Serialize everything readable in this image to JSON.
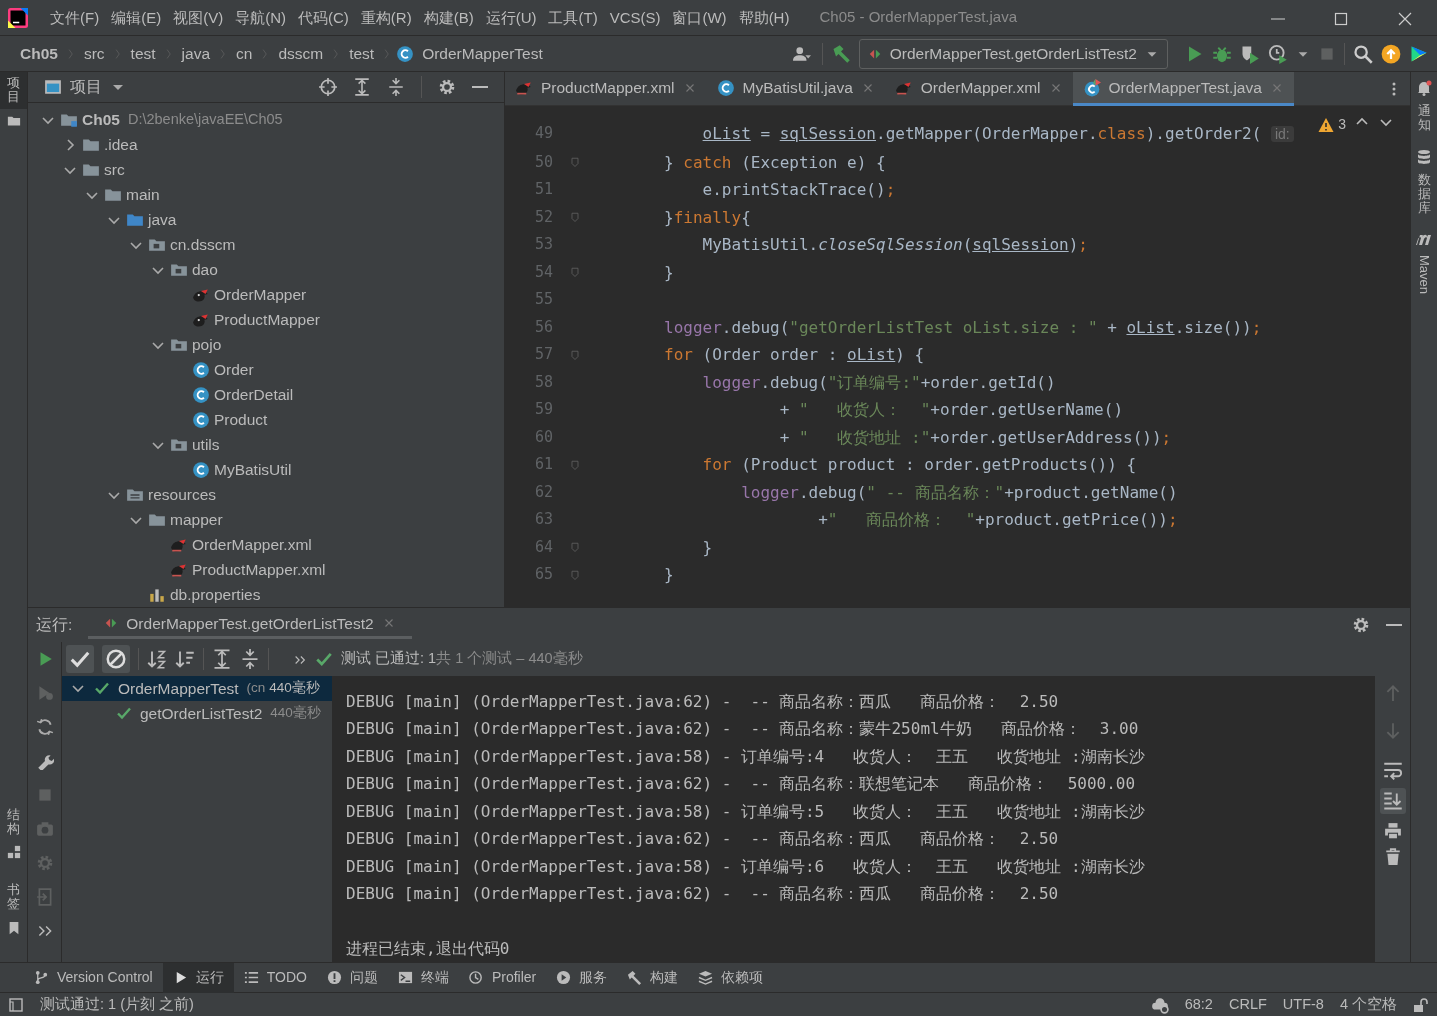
{
  "window": {
    "title": "Ch05 - OrderMapperTest.java"
  },
  "menu": [
    "文件(F)",
    "编辑(E)",
    "视图(V)",
    "导航(N)",
    "代码(C)",
    "重构(R)",
    "构建(B)",
    "运行(U)",
    "工具(T)",
    "VCS(S)",
    "窗口(W)",
    "帮助(H)"
  ],
  "breadcrumbs": [
    {
      "label": "Ch05",
      "kind": "root"
    },
    {
      "label": "src",
      "kind": "folder"
    },
    {
      "label": "test",
      "kind": "folder"
    },
    {
      "label": "java",
      "kind": "folder"
    },
    {
      "label": "cn",
      "kind": "folder"
    },
    {
      "label": "dsscm",
      "kind": "folder"
    },
    {
      "label": "test",
      "kind": "folder"
    },
    {
      "label": "OrderMapperTest",
      "kind": "class"
    }
  ],
  "run_configuration": {
    "label": "OrderMapperTest.getOrderListTest2"
  },
  "left_stripe": {
    "top": [
      {
        "label": "项目",
        "selected": true
      }
    ],
    "bottom": [
      {
        "label": "结构",
        "selected": false
      },
      {
        "label": "书签",
        "selected": false
      }
    ]
  },
  "right_stripe": [
    {
      "label": "通知",
      "kind": "bell"
    },
    {
      "label": "数据库",
      "kind": "database"
    },
    {
      "label": "Maven",
      "kind": "maven"
    }
  ],
  "project_panel": {
    "title": "项目",
    "tree": [
      {
        "label": "Ch05",
        "note": "D:\\2benke\\javaEE\\Ch05",
        "kind": "module",
        "expanded": true,
        "children": [
          {
            "label": ".idea",
            "kind": "folder",
            "expanded": false
          },
          {
            "label": "src",
            "kind": "folder",
            "expanded": true,
            "children": [
              {
                "label": "main",
                "kind": "folder",
                "expanded": true,
                "children": [
                  {
                    "label": "java",
                    "kind": "source",
                    "expanded": true,
                    "children": [
                      {
                        "label": "cn.dsscm",
                        "kind": "package",
                        "expanded": true,
                        "children": [
                          {
                            "label": "dao",
                            "kind": "package",
                            "expanded": true,
                            "children": [
                              {
                                "label": "OrderMapper",
                                "kind": "mapper"
                              },
                              {
                                "label": "ProductMapper",
                                "kind": "mapper"
                              }
                            ]
                          },
                          {
                            "label": "pojo",
                            "kind": "package",
                            "expanded": true,
                            "children": [
                              {
                                "label": "Order",
                                "kind": "class"
                              },
                              {
                                "label": "OrderDetail",
                                "kind": "class"
                              },
                              {
                                "label": "Product",
                                "kind": "class"
                              }
                            ]
                          },
                          {
                            "label": "utils",
                            "kind": "package",
                            "expanded": true,
                            "children": [
                              {
                                "label": "MyBatisUtil",
                                "kind": "class"
                              }
                            ]
                          }
                        ]
                      }
                    ]
                  },
                  {
                    "label": "resources",
                    "kind": "resources",
                    "expanded": true,
                    "children": [
                      {
                        "label": "mapper",
                        "kind": "folder",
                        "expanded": true,
                        "children": [
                          {
                            "label": "OrderMapper.xml",
                            "kind": "xml"
                          },
                          {
                            "label": "ProductMapper.xml",
                            "kind": "xml"
                          }
                        ]
                      },
                      {
                        "label": "db.properties",
                        "kind": "properties"
                      }
                    ]
                  }
                ]
              }
            ]
          }
        ]
      }
    ]
  },
  "editor": {
    "tabs": [
      {
        "label": "ProductMapper.xml",
        "kind": "xml",
        "selected": false
      },
      {
        "label": "MyBatisUtil.java",
        "kind": "class",
        "selected": false
      },
      {
        "label": "OrderMapper.xml",
        "kind": "xml",
        "selected": false
      },
      {
        "label": "OrderMapperTest.java",
        "kind": "test",
        "selected": true
      }
    ],
    "warnings": "3",
    "lines": [
      {
        "num": "49",
        "fold": false,
        "tokens": [
          {
            "text": "            oList",
            "kind": "underlined"
          },
          {
            "text": " = ",
            "kind": "plain"
          },
          {
            "text": "sqlSession",
            "kind": "underlined"
          },
          {
            "text": ".getMapper(OrderMapper.",
            "kind": "plain"
          },
          {
            "text": "class",
            "kind": "keyword"
          },
          {
            "text": ").getOrder2( ",
            "kind": "plain"
          },
          {
            "text": "id:",
            "kind": "hint"
          }
        ]
      },
      {
        "num": "50",
        "fold": true,
        "tokens": [
          {
            "text": "        } ",
            "kind": "plain"
          },
          {
            "text": "catch",
            "kind": "keyword"
          },
          {
            "text": " (Exception e) {",
            "kind": "plain"
          }
        ]
      },
      {
        "num": "51",
        "fold": false,
        "tokens": [
          {
            "text": "            e.printStackTrace()",
            "kind": "plain"
          },
          {
            "text": ";",
            "kind": "keyword"
          }
        ]
      },
      {
        "num": "52",
        "fold": true,
        "tokens": [
          {
            "text": "        }",
            "kind": "plain"
          },
          {
            "text": "finally",
            "kind": "keyword"
          },
          {
            "text": "{",
            "kind": "plain"
          }
        ]
      },
      {
        "num": "53",
        "fold": false,
        "tokens": [
          {
            "text": "            MyBatisUtil.",
            "kind": "plain"
          },
          {
            "text": "closeSqlSession",
            "kind": "italic"
          },
          {
            "text": "(",
            "kind": "plain"
          },
          {
            "text": "sqlSession",
            "kind": "underlined"
          },
          {
            "text": ")",
            "kind": "plain"
          },
          {
            "text": ";",
            "kind": "keyword"
          }
        ]
      },
      {
        "num": "54",
        "fold": true,
        "tokens": [
          {
            "text": "        }",
            "kind": "plain"
          }
        ]
      },
      {
        "num": "55",
        "fold": false
      },
      {
        "num": "56",
        "fold": false,
        "tokens": [
          {
            "text": "        logger",
            "kind": "field"
          },
          {
            "text": ".debug(",
            "kind": "plain"
          },
          {
            "text": "\"getOrderListTest oList.size : \"",
            "kind": "string"
          },
          {
            "text": " + ",
            "kind": "plain"
          },
          {
            "text": "oList",
            "kind": "underlined"
          },
          {
            "text": ".size())",
            "kind": "plain"
          },
          {
            "text": ";",
            "kind": "keyword"
          }
        ]
      },
      {
        "num": "57",
        "fold": true,
        "tokens": [
          {
            "text": "        for",
            "kind": "keyword"
          },
          {
            "text": " (Order order : ",
            "kind": "plain"
          },
          {
            "text": "oList",
            "kind": "underlined"
          },
          {
            "text": ") {",
            "kind": "plain"
          }
        ]
      },
      {
        "num": "58",
        "fold": false,
        "tokens": [
          {
            "text": "            logger",
            "kind": "field"
          },
          {
            "text": ".debug(",
            "kind": "plain"
          },
          {
            "text": "\"订单编号:\"",
            "kind": "string"
          },
          {
            "text": "+order.getId()",
            "kind": "plain"
          }
        ]
      },
      {
        "num": "59",
        "fold": false,
        "tokens": [
          {
            "text": "                    + ",
            "kind": "plain"
          },
          {
            "text": "\"   收货人：  \"",
            "kind": "string"
          },
          {
            "text": "+order.getUserName()",
            "kind": "plain"
          }
        ]
      },
      {
        "num": "60",
        "fold": false,
        "tokens": [
          {
            "text": "                    + ",
            "kind": "plain"
          },
          {
            "text": "\"   收货地址 :\"",
            "kind": "string"
          },
          {
            "text": "+order.getUserAddress())",
            "kind": "plain"
          },
          {
            "text": ";",
            "kind": "keyword"
          }
        ]
      },
      {
        "num": "61",
        "fold": true,
        "tokens": [
          {
            "text": "            for",
            "kind": "keyword"
          },
          {
            "text": " (Product product : order.getProducts()) {",
            "kind": "plain"
          }
        ]
      },
      {
        "num": "62",
        "fold": false,
        "tokens": [
          {
            "text": "                logger",
            "kind": "field"
          },
          {
            "text": ".debug(",
            "kind": "plain"
          },
          {
            "text": "\" -- 商品名称：\"",
            "kind": "string"
          },
          {
            "text": "+product.getName()",
            "kind": "plain"
          }
        ]
      },
      {
        "num": "63",
        "fold": false,
        "tokens": [
          {
            "text": "                        +",
            "kind": "plain"
          },
          {
            "text": "\"   商品价格：  \"",
            "kind": "string"
          },
          {
            "text": "+product.getPrice())",
            "kind": "plain"
          },
          {
            "text": ";",
            "kind": "keyword"
          }
        ]
      },
      {
        "num": "64",
        "fold": true,
        "tokens": [
          {
            "text": "            }",
            "kind": "plain"
          }
        ]
      },
      {
        "num": "65",
        "fold": true,
        "tokens": [
          {
            "text": "        }",
            "kind": "plain"
          }
        ]
      }
    ]
  },
  "run_panel": {
    "label": "运行:",
    "tab": "OrderMapperTest.getOrderListTest2",
    "summary": {
      "status": "测试 已通过: 1",
      "detail": "共 1 个测试 – 440毫秒"
    },
    "tests": [
      {
        "label": "OrderMapperTest",
        "note": "(cn",
        "time": "440毫秒",
        "passed": true,
        "selected": true,
        "expanded": true,
        "children": [
          {
            "label": "getOrderListTest2",
            "time": "440毫秒",
            "passed": true,
            "selected": false
          }
        ]
      }
    ],
    "console": {
      "lines": [
        "DEBUG [main] (OrderMapperTest.java:62) -  -- 商品名称：西瓜   商品价格：  2.50",
        "DEBUG [main] (OrderMapperTest.java:62) -  -- 商品名称：蒙牛250ml牛奶   商品价格：  3.00",
        "DEBUG [main] (OrderMapperTest.java:58) - 订单编号:4   收货人：  王五   收货地址 :湖南长沙",
        "DEBUG [main] (OrderMapperTest.java:62) -  -- 商品名称：联想笔记本   商品价格：  5000.00",
        "DEBUG [main] (OrderMapperTest.java:58) - 订单编号:5   收货人：  王五   收货地址 :湖南长沙",
        "DEBUG [main] (OrderMapperTest.java:62) -  -- 商品名称：西瓜   商品价格：  2.50",
        "DEBUG [main] (OrderMapperTest.java:58) - 订单编号:6   收货人：  王五   收货地址 :湖南长沙",
        "DEBUG [main] (OrderMapperTest.java:62) -  -- 商品名称：西瓜   商品价格：  2.50"
      ],
      "exit": "进程已结束,退出代码0"
    }
  },
  "tool_tabs": [
    {
      "label": "Version Control",
      "kind": "vcs",
      "selected": false
    },
    {
      "label": "运行",
      "kind": "run",
      "selected": true
    },
    {
      "label": "TODO",
      "kind": "todo",
      "selected": false
    },
    {
      "label": "问题",
      "kind": "problems",
      "selected": false
    },
    {
      "label": "终端",
      "kind": "terminal",
      "selected": false
    },
    {
      "label": "Profiler",
      "kind": "profiler",
      "selected": false
    },
    {
      "label": "服务",
      "kind": "services",
      "selected": false
    },
    {
      "label": "构建",
      "kind": "build",
      "selected": false
    },
    {
      "label": "依赖项",
      "kind": "deps",
      "selected": false
    }
  ],
  "status_bar": {
    "message": "测试通过: 1 (片刻 之前)",
    "position": "68:2",
    "line_separator": "CRLF",
    "encoding": "UTF-8",
    "indent": "4 个空格"
  }
}
